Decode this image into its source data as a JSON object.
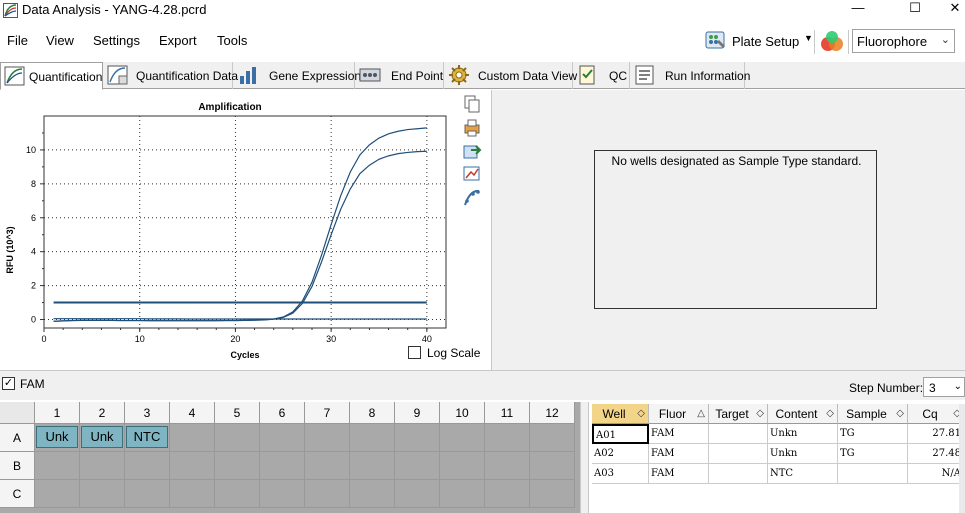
{
  "window": {
    "title": "Data Analysis - YANG-4.28.pcrd"
  },
  "menu": {
    "file": "File",
    "view": "View",
    "settings": "Settings",
    "export": "Export",
    "tools": "Tools"
  },
  "toolbar": {
    "plate_setup": "Plate Setup",
    "fluor_select": "Fluorophore"
  },
  "tabs": [
    {
      "label": "Quantification"
    },
    {
      "label": "Quantification Data"
    },
    {
      "label": "Gene Expression"
    },
    {
      "label": "End Point"
    },
    {
      "label": "Custom Data View"
    },
    {
      "label": "QC"
    },
    {
      "label": "Run Information"
    }
  ],
  "chart_data": {
    "type": "line",
    "title": "Amplification",
    "xlabel": "Cycles",
    "ylabel": "RFU (10^3)",
    "xlim": [
      0,
      42
    ],
    "ylim": [
      -0.5,
      12
    ],
    "xticks": [
      "0",
      "10",
      "20",
      "30",
      "40"
    ],
    "yticks": [
      "0",
      "2",
      "4",
      "6",
      "8",
      "10"
    ],
    "grid": "dotted",
    "threshold": 1.0,
    "x": [
      1,
      2,
      3,
      4,
      5,
      6,
      7,
      8,
      9,
      10,
      11,
      12,
      13,
      14,
      15,
      16,
      17,
      18,
      19,
      20,
      21,
      22,
      23,
      24,
      25,
      26,
      27,
      28,
      29,
      30,
      31,
      32,
      33,
      34,
      35,
      36,
      37,
      38,
      39,
      40
    ],
    "series": [
      {
        "values": [
          -0.1,
          -0.08,
          -0.06,
          -0.05,
          -0.05,
          -0.05,
          -0.05,
          -0.06,
          -0.06,
          -0.06,
          -0.07,
          -0.07,
          -0.07,
          -0.07,
          -0.07,
          -0.07,
          -0.07,
          -0.07,
          -0.06,
          -0.06,
          -0.05,
          -0.04,
          -0.02,
          0.03,
          0.15,
          0.45,
          1.1,
          2.2,
          3.8,
          5.6,
          7.3,
          8.7,
          9.7,
          10.3,
          10.7,
          10.95,
          11.1,
          11.2,
          11.25,
          11.3
        ]
      },
      {
        "values": [
          -0.1,
          -0.08,
          -0.06,
          -0.05,
          -0.05,
          -0.05,
          -0.05,
          -0.06,
          -0.06,
          -0.06,
          -0.07,
          -0.07,
          -0.07,
          -0.07,
          -0.07,
          -0.07,
          -0.07,
          -0.07,
          -0.06,
          -0.06,
          -0.05,
          -0.04,
          -0.02,
          0.02,
          0.12,
          0.38,
          0.95,
          1.95,
          3.4,
          5.0,
          6.5,
          7.7,
          8.6,
          9.1,
          9.45,
          9.65,
          9.78,
          9.85,
          9.9,
          9.92
        ]
      },
      {
        "values": [
          0.05,
          0.05,
          0.05,
          0.05,
          0.05,
          0.05,
          0.05,
          0.05,
          0.05,
          0.05,
          0.04,
          0.04,
          0.04,
          0.04,
          0.03,
          0.03,
          0.03,
          0.03,
          0.03,
          0.03,
          0.03,
          0.03,
          0.03,
          0.03,
          0.03,
          0.03,
          0.03,
          0.03,
          0.03,
          0.03,
          0.03,
          0.03,
          0.03,
          0.03,
          0.03,
          0.03,
          0.03,
          0.03,
          0.03,
          0.03
        ]
      }
    ]
  },
  "chart_options": {
    "log_scale_label": "Log Scale",
    "log_scale_checked": false
  },
  "standard_panel": {
    "message": "No wells designated as Sample Type standard."
  },
  "fam_bar": {
    "fam_label": "FAM",
    "fam_checked": true,
    "step_label": "Step Number:",
    "step_value": "3"
  },
  "plate": {
    "columns": [
      "1",
      "2",
      "3",
      "4",
      "5",
      "6",
      "7",
      "8",
      "9",
      "10",
      "11",
      "12"
    ],
    "rows": [
      "A",
      "B",
      "C"
    ],
    "wells": [
      {
        "row": 0,
        "col": 0,
        "label": "Unk"
      },
      {
        "row": 0,
        "col": 1,
        "label": "Unk"
      },
      {
        "row": 0,
        "col": 2,
        "label": "NTC"
      }
    ]
  },
  "well_table": {
    "headers": [
      "Well",
      "Fluor",
      "Target",
      "Content",
      "Sample",
      "Cq"
    ],
    "rows": [
      [
        "A01",
        "FAM",
        "",
        "Unkn",
        "TG",
        "27.81"
      ],
      [
        "A02",
        "FAM",
        "",
        "Unkn",
        "TG",
        "27.48"
      ],
      [
        "A03",
        "FAM",
        "",
        "NTC",
        "",
        "N/A"
      ]
    ]
  },
  "colors": {
    "accent_well": "#7fb5c2",
    "plate_bg": "#a9a9a9",
    "curve": "#1f4e79",
    "active_header": "#f3d58a"
  }
}
